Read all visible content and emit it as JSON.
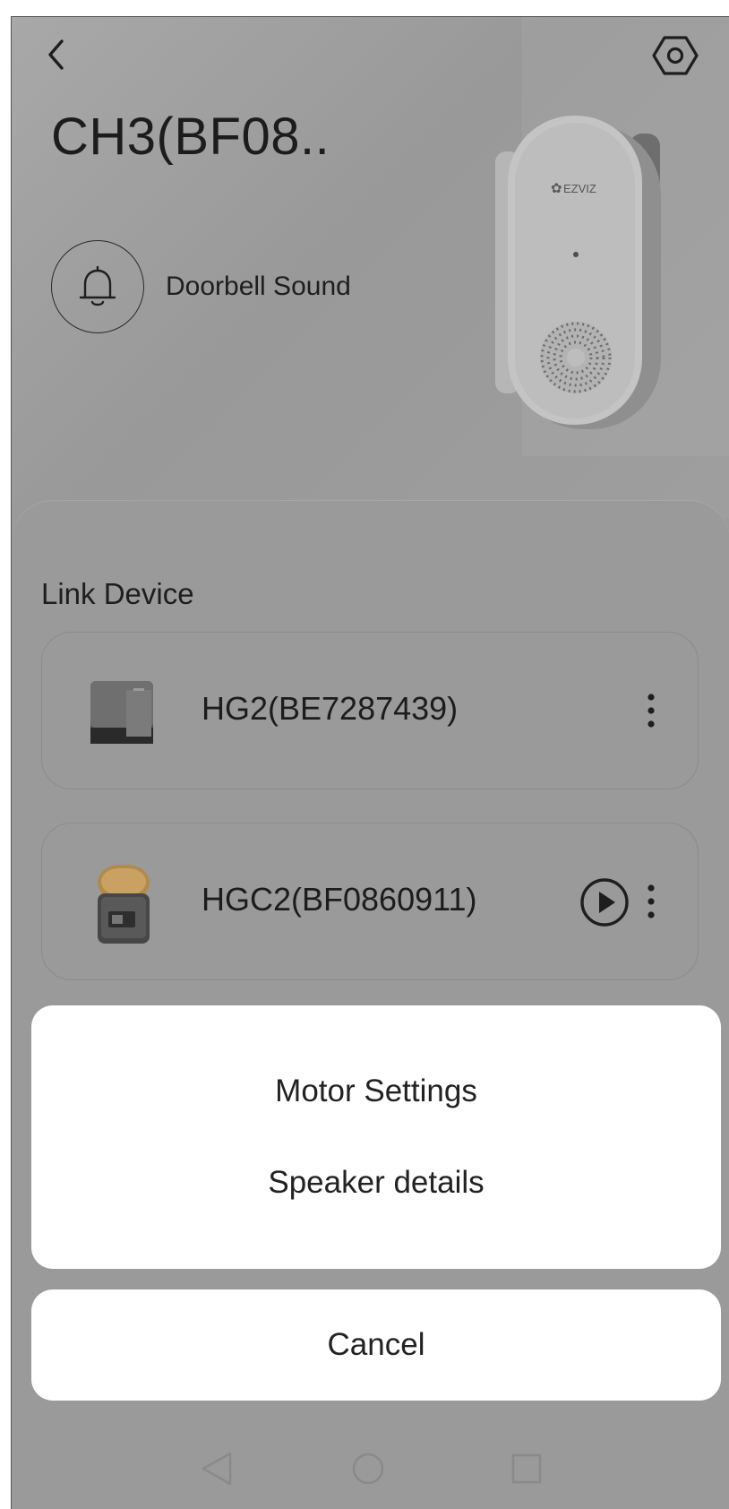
{
  "header": {
    "title": "CH3(BF08..",
    "back_icon": "chevron-left-icon",
    "settings_icon": "hexagon-settings-icon"
  },
  "doorbell": {
    "label": "Doorbell Sound",
    "icon": "bell-icon",
    "brand": "EZVIZ"
  },
  "link_device": {
    "title": "Link Device",
    "devices": [
      {
        "name": "HG2(BE7287439)",
        "has_play": false
      },
      {
        "name": "HGC2(BF0860911)",
        "has_play": true
      }
    ]
  },
  "action_sheet": {
    "options": [
      "Motor Settings",
      "Speaker details"
    ],
    "cancel_label": "Cancel"
  },
  "colors": {
    "overlay": "#9b9b9b",
    "sheet_bg": "#ffffff",
    "text": "#1c1c1c"
  }
}
